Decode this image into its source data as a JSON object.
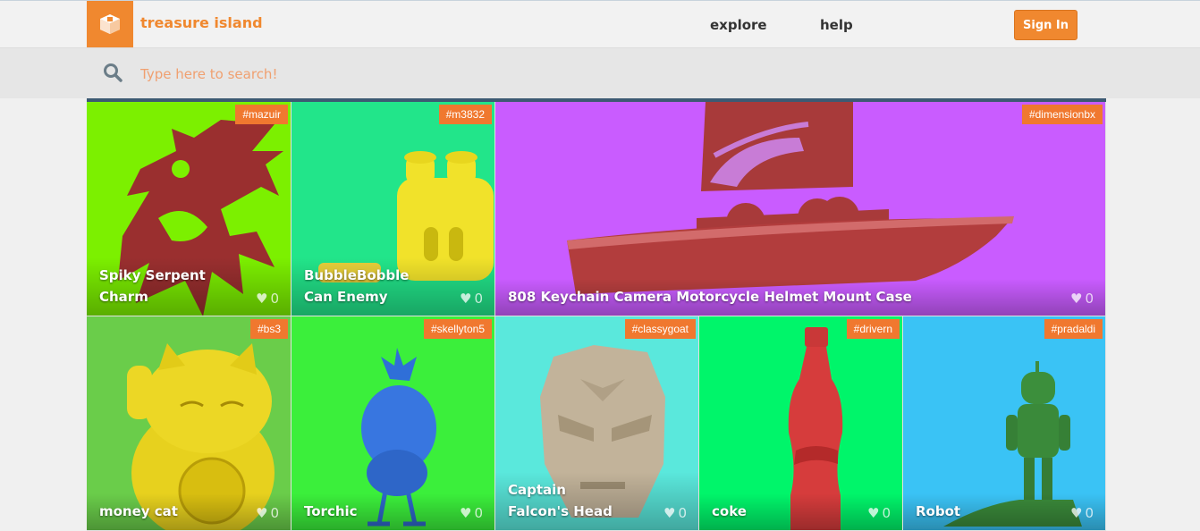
{
  "header": {
    "brand": "treasure island",
    "nav": [
      {
        "label": "explore"
      },
      {
        "label": "help"
      }
    ],
    "signin_label": "Sign In"
  },
  "search": {
    "placeholder": "Type here to search!"
  },
  "colors": {
    "accent": "#f0882f",
    "tag": "#f0782f",
    "divider": "#3d5a73"
  },
  "items": [
    {
      "title": "Spiky Serpent Charm",
      "tag": "#mazuir",
      "likes": "0",
      "bg": "#7cf000"
    },
    {
      "title": "BubbleBobble Can Enemy",
      "tag": "#m3832",
      "likes": "0",
      "bg": "#22e58a"
    },
    {
      "title": "808 Keychain Camera Motorcycle Helmet Mount Case",
      "tag": "#dimensionbx",
      "likes": "0",
      "bg": "#c95cff"
    },
    {
      "title": "money cat",
      "tag": "#bs3",
      "likes": "0",
      "bg": "#6acd4a"
    },
    {
      "title": "Torchic",
      "tag": "#skellyton5",
      "likes": "0",
      "bg": "#3bef3b"
    },
    {
      "title": "Captain Falcon's Head",
      "tag": "#classygoat",
      "likes": "0",
      "bg": "#5ae8dc"
    },
    {
      "title": "coke",
      "tag": "#drivern",
      "likes": "0",
      "bg": "#00f56a"
    },
    {
      "title": "Robot",
      "tag": "#pradaldi",
      "likes": "0",
      "bg": "#3ac3f5"
    }
  ]
}
